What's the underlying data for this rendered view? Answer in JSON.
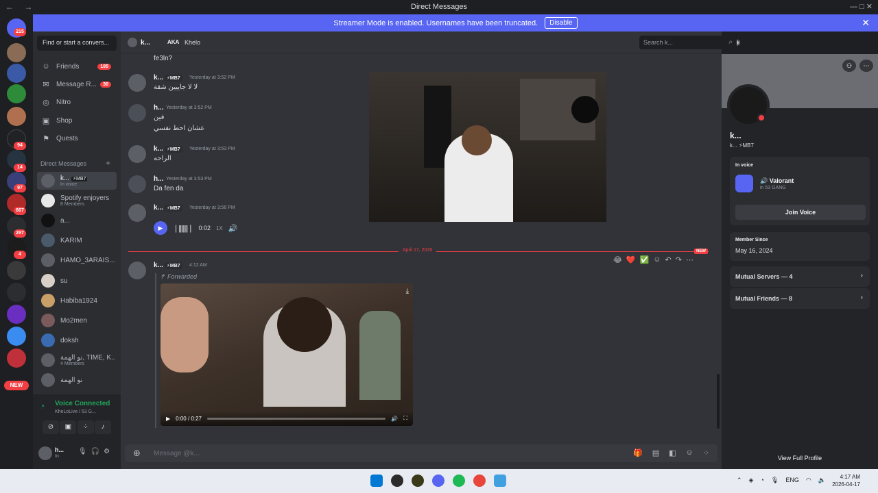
{
  "titlebar": {
    "title": "Direct Messages",
    "nav": "← →",
    "window_controls": "— □ ✕"
  },
  "banner": {
    "text": "Streamer Mode is enabled. Usernames have been truncated.",
    "disable_label": "Disable",
    "close_glyph": "✕"
  },
  "servers": {
    "badges": [
      "215",
      "94",
      "14",
      "97",
      "667",
      "297",
      "4"
    ],
    "new_label": "NEW"
  },
  "sidebar": {
    "search_placeholder": "Find or start a convers...",
    "nav": [
      {
        "icon": "friends-icon",
        "glyph": "☺",
        "label": "Friends",
        "badge": "185"
      },
      {
        "icon": "message-requests-icon",
        "glyph": "✉",
        "label": "Message R...",
        "badge": "30"
      },
      {
        "icon": "nitro-icon",
        "glyph": "◎",
        "label": "Nitro",
        "badge": ""
      },
      {
        "icon": "shop-icon",
        "glyph": "▣",
        "label": "Shop",
        "badge": ""
      },
      {
        "icon": "quests-icon",
        "glyph": "⚑",
        "label": "Quests",
        "badge": ""
      }
    ],
    "dm_header": "Direct Messages",
    "dm_plus": "+",
    "dms": [
      {
        "name": "k...",
        "sub": "In voice",
        "tag": "MB7"
      },
      {
        "name": "Spotify enjoyers",
        "sub": "8 Members"
      },
      {
        "name": "a...",
        "sub": ""
      },
      {
        "name": "KARIM",
        "sub": ""
      },
      {
        "name": "HAMO_3ARAIS...",
        "sub": ""
      },
      {
        "name": "su",
        "sub": ""
      },
      {
        "name": "Habiba1924",
        "sub": ""
      },
      {
        "name": "Mo2men",
        "sub": ""
      },
      {
        "name": "doksh",
        "sub": ""
      },
      {
        "name": "نو الهمة, TIME, K...",
        "sub": "4 Members"
      },
      {
        "name": "نو الهمة",
        "sub": ""
      }
    ],
    "voice": {
      "status": "Voice Connected",
      "channel": "KheLoLive / 53 G..."
    },
    "user": {
      "name": "h...",
      "status": "In"
    }
  },
  "chat": {
    "header": {
      "name": "k...",
      "aka_label": "AKA",
      "aka_value": "Khelo"
    },
    "search_placeholder": "Search k...",
    "messages": [
      {
        "text": "fe3ln?"
      },
      {
        "user": "k...",
        "tag": "MB7",
        "time": "Yesterday at 3:52 PM",
        "text": "لا لا جاييين شقة"
      },
      {
        "user": "h...",
        "time": "Yesterday at 3:52 PM",
        "line1": "فين",
        "line2": "عشان احط نفسي"
      },
      {
        "user": "k...",
        "tag": "MB7",
        "time": "Yesterday at 3:53 PM",
        "text": "الراحه"
      },
      {
        "user": "h...",
        "time": "Yesterday at 3:53 PM",
        "text": "Da fen da"
      },
      {
        "user": "k...",
        "tag": "MB7",
        "time": "Yesterday at 3:56 PM"
      }
    ],
    "audio": {
      "time": "0:02",
      "speed": "1X",
      "wave": "❘|||||||❘"
    },
    "divider_date": "April 17, 2026",
    "new_label": "NEW",
    "forward_msg": {
      "user": "k...",
      "tag": "MB7",
      "time": "4:12 AM",
      "forwarded_label": "Forwarded",
      "video_time": "0:00 / 0:27"
    },
    "reactions": [
      "😂",
      "❤️",
      "✅"
    ],
    "composer_placeholder": "Message @k..."
  },
  "profile": {
    "name": "k...",
    "tag_line": "k...  ⚡MB7",
    "in_voice_label": "In voice",
    "voice_game": "Valorant",
    "voice_server": "in 53 GANG",
    "join_label": "Join Voice",
    "member_since_label": "Member Since",
    "member_since": "May 16, 2024",
    "mutual_servers": "Mutual Servers — 4",
    "mutual_friends": "Mutual Friends — 8",
    "view_full": "View Full Profile"
  },
  "taskbar": {
    "lang": "ENG",
    "time": "4:17 AM",
    "date": "2026-04-17"
  },
  "colors": {
    "accent": "#5865f2",
    "danger": "#f23f43",
    "online": "#23a55a"
  }
}
